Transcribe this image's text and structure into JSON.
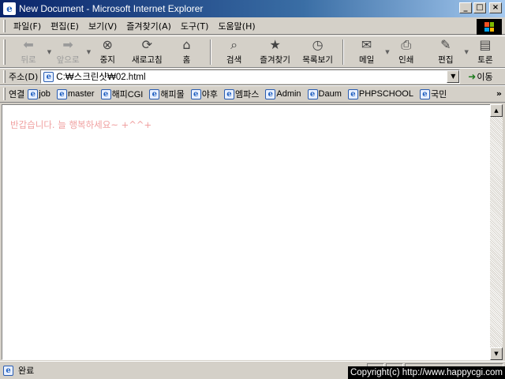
{
  "window": {
    "title": "New Document - Microsoft Internet Explorer"
  },
  "menu": [
    "파일(F)",
    "편집(E)",
    "보기(V)",
    "즐겨찾기(A)",
    "도구(T)",
    "도움말(H)"
  ],
  "toolbar": {
    "back": "뒤로",
    "forward": "앞으로",
    "stop": "중지",
    "refresh": "새로고침",
    "home": "홈",
    "search": "검색",
    "favorites": "즐겨찾기",
    "history": "목록보기",
    "mail": "메일",
    "print": "인쇄",
    "edit": "편집",
    "discuss": "토론"
  },
  "address": {
    "label": "주소(D)",
    "value": "C:₩스크린샷₩02.html",
    "go": "이동"
  },
  "links": {
    "label": "연결",
    "items": [
      "job",
      "master",
      "해피CGI",
      "해피몰",
      "야후",
      "엠파스",
      "Admin",
      "Daum",
      "PHPSCHOOL",
      "국민"
    ]
  },
  "content": {
    "greeting": "반갑습니다. 늘 행복하세요~ +^^+"
  },
  "status": {
    "text": "완료",
    "copyright": "Copyright(c) http://www.happycgi.com"
  }
}
